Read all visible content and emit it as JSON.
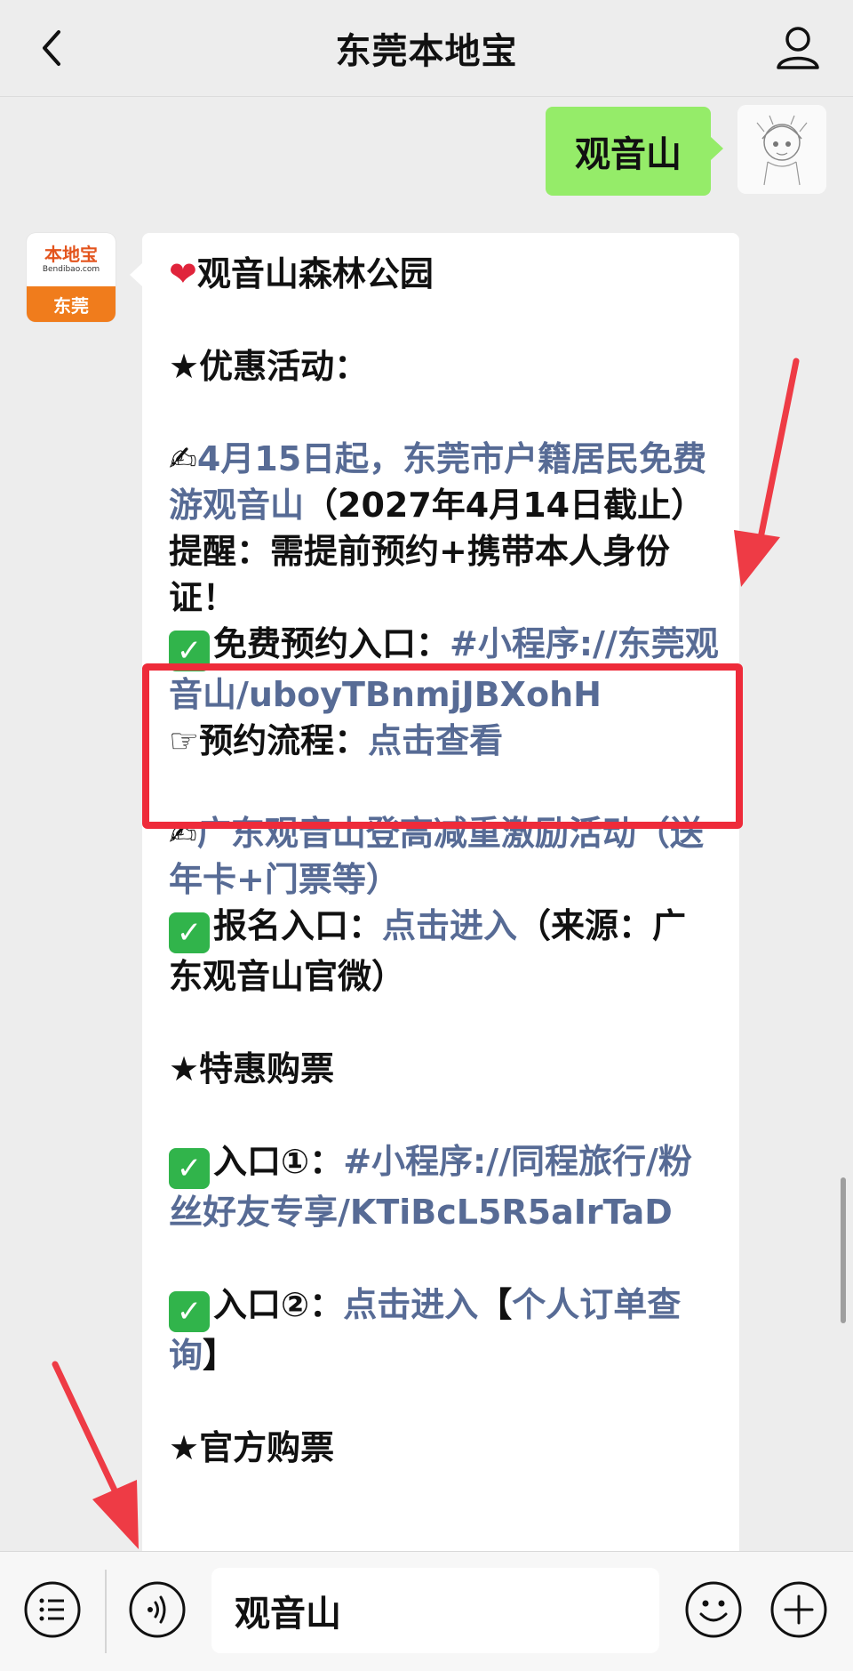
{
  "header": {
    "title": "东莞本地宝"
  },
  "user_message": {
    "text": "观音山"
  },
  "bot_avatar": {
    "logo_text": "本地宝",
    "logo_sub": "Bendibao.com",
    "city": "东莞"
  },
  "message": {
    "line1_text": "观音山森林公园",
    "section1_title": "★优惠活动：",
    "promo1_link": "4月15日起，东莞市户籍居民免费游观音山",
    "promo1_text": "（2027年4月14日截止）",
    "reminder": "提醒：需提前预约+携带本人身份证！",
    "booking_label": "免费预约入口：",
    "booking_link": "#小程序://东莞观音山/uboyTBnmjJBXohH",
    "flow_label": "预约流程：",
    "flow_link": "点击查看",
    "event_link": "广东观音山登高减重激励活动（送年卡+门票等）",
    "signup_label": "报名入口：",
    "signup_link": "点击进入",
    "signup_source": "（来源：广东观音山官微）",
    "section2_title": "★特惠购票",
    "entry1_label": "入口①：",
    "entry1_link": "#小程序://同程旅行/粉丝好友专享/KTiBcL5R5aIrTaD",
    "entry2_label": "入口②：",
    "entry2_link": "点击进入",
    "entry2_bracket_open": "【",
    "entry2_link2": "个人订单查询",
    "entry2_bracket_close": "】",
    "section3_title": "★官方购票"
  },
  "input": {
    "value": "观音山"
  },
  "icons": [
    "back-icon",
    "user-icon",
    "menu-list-icon",
    "voice-icon",
    "emoji-icon",
    "plus-icon",
    "heart-icon",
    "writing-hand-icon",
    "check-mark-icon",
    "pointing-hand-icon"
  ],
  "colors": {
    "user_bubble": "#95ec69",
    "link": "#576b95",
    "highlight": "#ee2b3a",
    "arrow": "#ee3b45",
    "check": "#31b44b"
  }
}
